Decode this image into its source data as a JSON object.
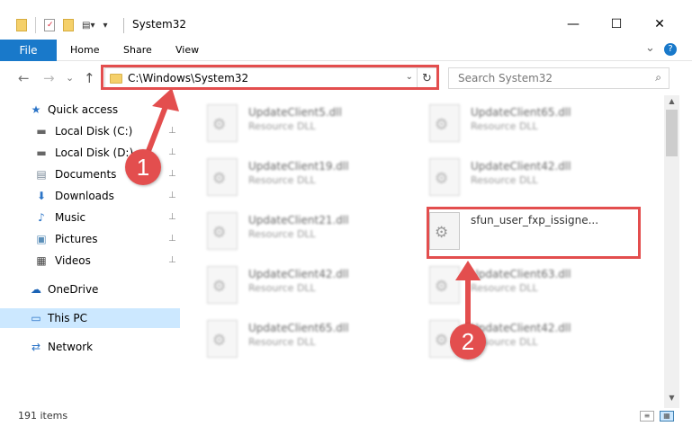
{
  "window": {
    "title": "System32",
    "minimize": "—",
    "maximize": "☐",
    "close": "✕"
  },
  "ribbon": {
    "tabs": [
      "File",
      "Home",
      "Share",
      "View"
    ],
    "expand": "⌄",
    "help": "?"
  },
  "nav": {
    "back": "←",
    "forward": "→",
    "recent": "⌄",
    "up": "↑",
    "address": "C:\\Windows\\System32",
    "address_dropdown": "⌄",
    "refresh": "↻",
    "search_placeholder": "Search System32",
    "search_icon": "⌕"
  },
  "sidebar": {
    "items": [
      {
        "label": "Quick access",
        "icon": "star-icon",
        "glyph": "★",
        "color": "#2b74c7",
        "pinned": false
      },
      {
        "label": "Local Disk (C:)",
        "icon": "drive-icon",
        "glyph": "▬",
        "color": "#666666",
        "pinned": true
      },
      {
        "label": "Local Disk (D:)",
        "icon": "drive-icon",
        "glyph": "▬",
        "color": "#666666",
        "pinned": true
      },
      {
        "label": "Documents",
        "icon": "documents-icon",
        "glyph": "▤",
        "color": "#7a8a99",
        "pinned": true
      },
      {
        "label": "Downloads",
        "icon": "download-icon",
        "glyph": "⬇",
        "color": "#2b74c7",
        "pinned": true
      },
      {
        "label": "Music",
        "icon": "music-icon",
        "glyph": "♪",
        "color": "#2b74c7",
        "pinned": true
      },
      {
        "label": "Pictures",
        "icon": "pictures-icon",
        "glyph": "▣",
        "color": "#5b8fb9",
        "pinned": true
      },
      {
        "label": "Videos",
        "icon": "videos-icon",
        "glyph": "▦",
        "color": "#444444",
        "pinned": true
      },
      {
        "label": "OneDrive",
        "icon": "onedrive-icon",
        "glyph": "☁",
        "color": "#1b63b5",
        "pinned": false
      },
      {
        "label": "This PC",
        "icon": "this-pc-icon",
        "glyph": "▭",
        "color": "#2b74c7",
        "pinned": false,
        "selected": true
      },
      {
        "label": "Network",
        "icon": "network-icon",
        "glyph": "⇄",
        "color": "#2b74c7",
        "pinned": false
      }
    ],
    "pin_glyph": "📌"
  },
  "files": [
    {
      "name": "UpdateClient5.dll",
      "desc": "Resource DLL"
    },
    {
      "name": "UpdateClient65.dll",
      "desc": "Resource DLL"
    },
    {
      "name": "UpdateClient19.dll",
      "desc": "Resource DLL"
    },
    {
      "name": "UpdateClient42.dll",
      "desc": "Resource DLL"
    },
    {
      "name": "UpdateClient21.dll",
      "desc": "Resource DLL"
    },
    {
      "name": "sfun_user_fxp_issigne...",
      "desc": ""
    },
    {
      "name": "UpdateClient42.dll",
      "desc": "Resource DLL"
    },
    {
      "name": "UpdateClient63.dll",
      "desc": "Resource DLL"
    },
    {
      "name": "UpdateClient65.dll",
      "desc": "Resource DLL"
    },
    {
      "name": "UpdateClient42.dll",
      "desc": "Resource DLL"
    }
  ],
  "status": {
    "item_count": "191 items"
  },
  "annotations": {
    "step1": "1",
    "step2": "2",
    "color": "#e34e4e"
  }
}
